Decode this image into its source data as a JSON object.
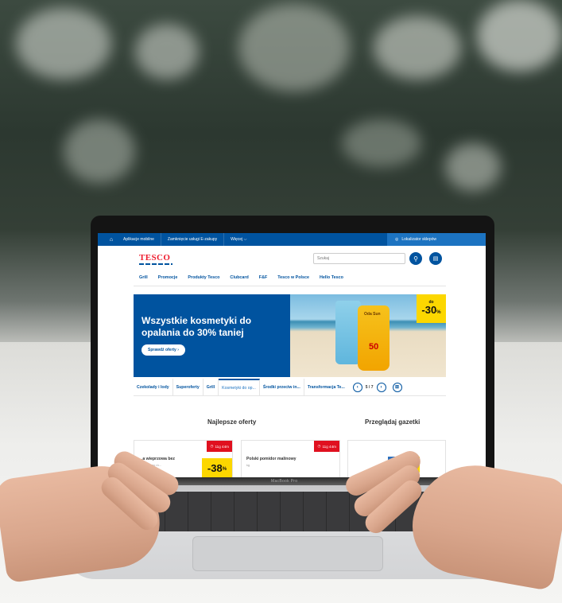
{
  "topbar": {
    "links": [
      "Aplikacje mobilne",
      "Zamknięcie usługi E-zakupy",
      "Więcej"
    ],
    "store_locator": "Lokalizator sklepów"
  },
  "header": {
    "logo": "TESCO",
    "search_placeholder": "Szukaj"
  },
  "nav": [
    "Grill",
    "Promocje",
    "Produkty Tesco",
    "Clubcard",
    "F&F",
    "Tesco w Polsce",
    "Hello Tesco"
  ],
  "banner": {
    "title": "Wszystkie kosmetyki do opalania do 30% taniej",
    "button": "Sprawdź oferty",
    "discount_prefix": "do",
    "discount_value": "-30",
    "discount_unit": "%",
    "product_brand": "Oda Sun",
    "product_spf": "50"
  },
  "category_tabs": {
    "items": [
      "Czekolady i lody",
      "Superoferty",
      "Grill",
      "Kosmetyki do op...",
      "Środki przeciw in...",
      "Transformacja Te..."
    ],
    "active_index": 3,
    "page": "5 / 7"
  },
  "sections": {
    "best_offers": "Najlepsze oferty",
    "leaflets": "Przeglądaj gazetki"
  },
  "cards": [
    {
      "timer": "11g 44m",
      "name": "...a wieprzowa bez",
      "sub": "...ezpieczno ró...",
      "discount": "-38",
      "unit": "%"
    },
    {
      "timer": "11g 44m",
      "name": "Polski pomidor malinowy",
      "sub": "kg"
    }
  ],
  "laptop_brand": "MacBook Pro"
}
